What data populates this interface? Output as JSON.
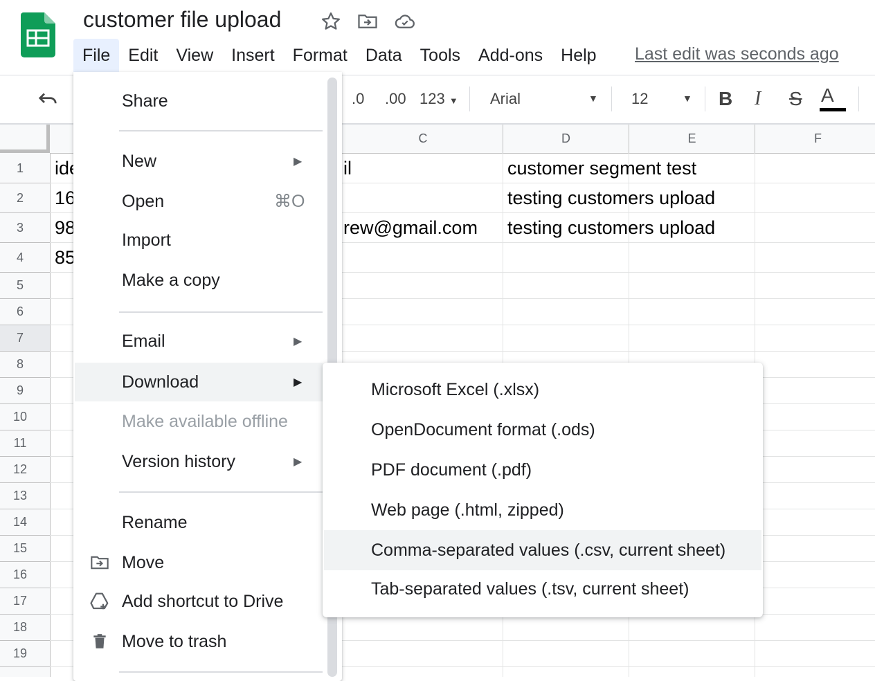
{
  "app": {
    "title": "customer file upload",
    "last_edit": "Last edit was seconds ago"
  },
  "menubar": [
    "File",
    "Edit",
    "View",
    "Insert",
    "Format",
    "Data",
    "Tools",
    "Add-ons",
    "Help"
  ],
  "toolbar": {
    "decimal_decrease": ".0",
    "decimal_increase": ".00",
    "number_format": "123",
    "font": "Arial",
    "font_size": "12",
    "bold": "B",
    "italic": "I",
    "strikethrough": "S",
    "text_color": "A"
  },
  "grid": {
    "columns": [
      "C",
      "D",
      "E",
      "F"
    ],
    "rows": [
      "1",
      "2",
      "3",
      "4",
      "5",
      "6",
      "7",
      "8",
      "9",
      "10",
      "11",
      "12",
      "13",
      "14",
      "15",
      "16",
      "17",
      "18",
      "19"
    ],
    "cells": {
      "A1": "ide",
      "A2": "16",
      "A3": "98",
      "A4": "85",
      "C1": "il",
      "C3": "rew@gmail.com",
      "D1": "customer segment test",
      "D2": "testing customers upload",
      "D3": "testing customers upload"
    }
  },
  "file_menu": {
    "share": "Share",
    "new": "New",
    "open": "Open",
    "open_shortcut": "⌘O",
    "import": "Import",
    "make_copy": "Make a copy",
    "email": "Email",
    "download": "Download",
    "make_offline": "Make available offline",
    "version_history": "Version history",
    "rename": "Rename",
    "move": "Move",
    "add_shortcut": "Add shortcut to Drive",
    "move_to_trash": "Move to trash"
  },
  "download_menu": [
    "Microsoft Excel (.xlsx)",
    "OpenDocument format (.ods)",
    "PDF document (.pdf)",
    "Web page (.html, zipped)",
    "Comma-separated values (.csv, current sheet)",
    "Tab-separated values (.tsv, current sheet)"
  ],
  "colors": {
    "sheets_green": "#0f9d58",
    "menu_highlight": "#f1f3f4",
    "active_menu": "#e8f0fe"
  }
}
